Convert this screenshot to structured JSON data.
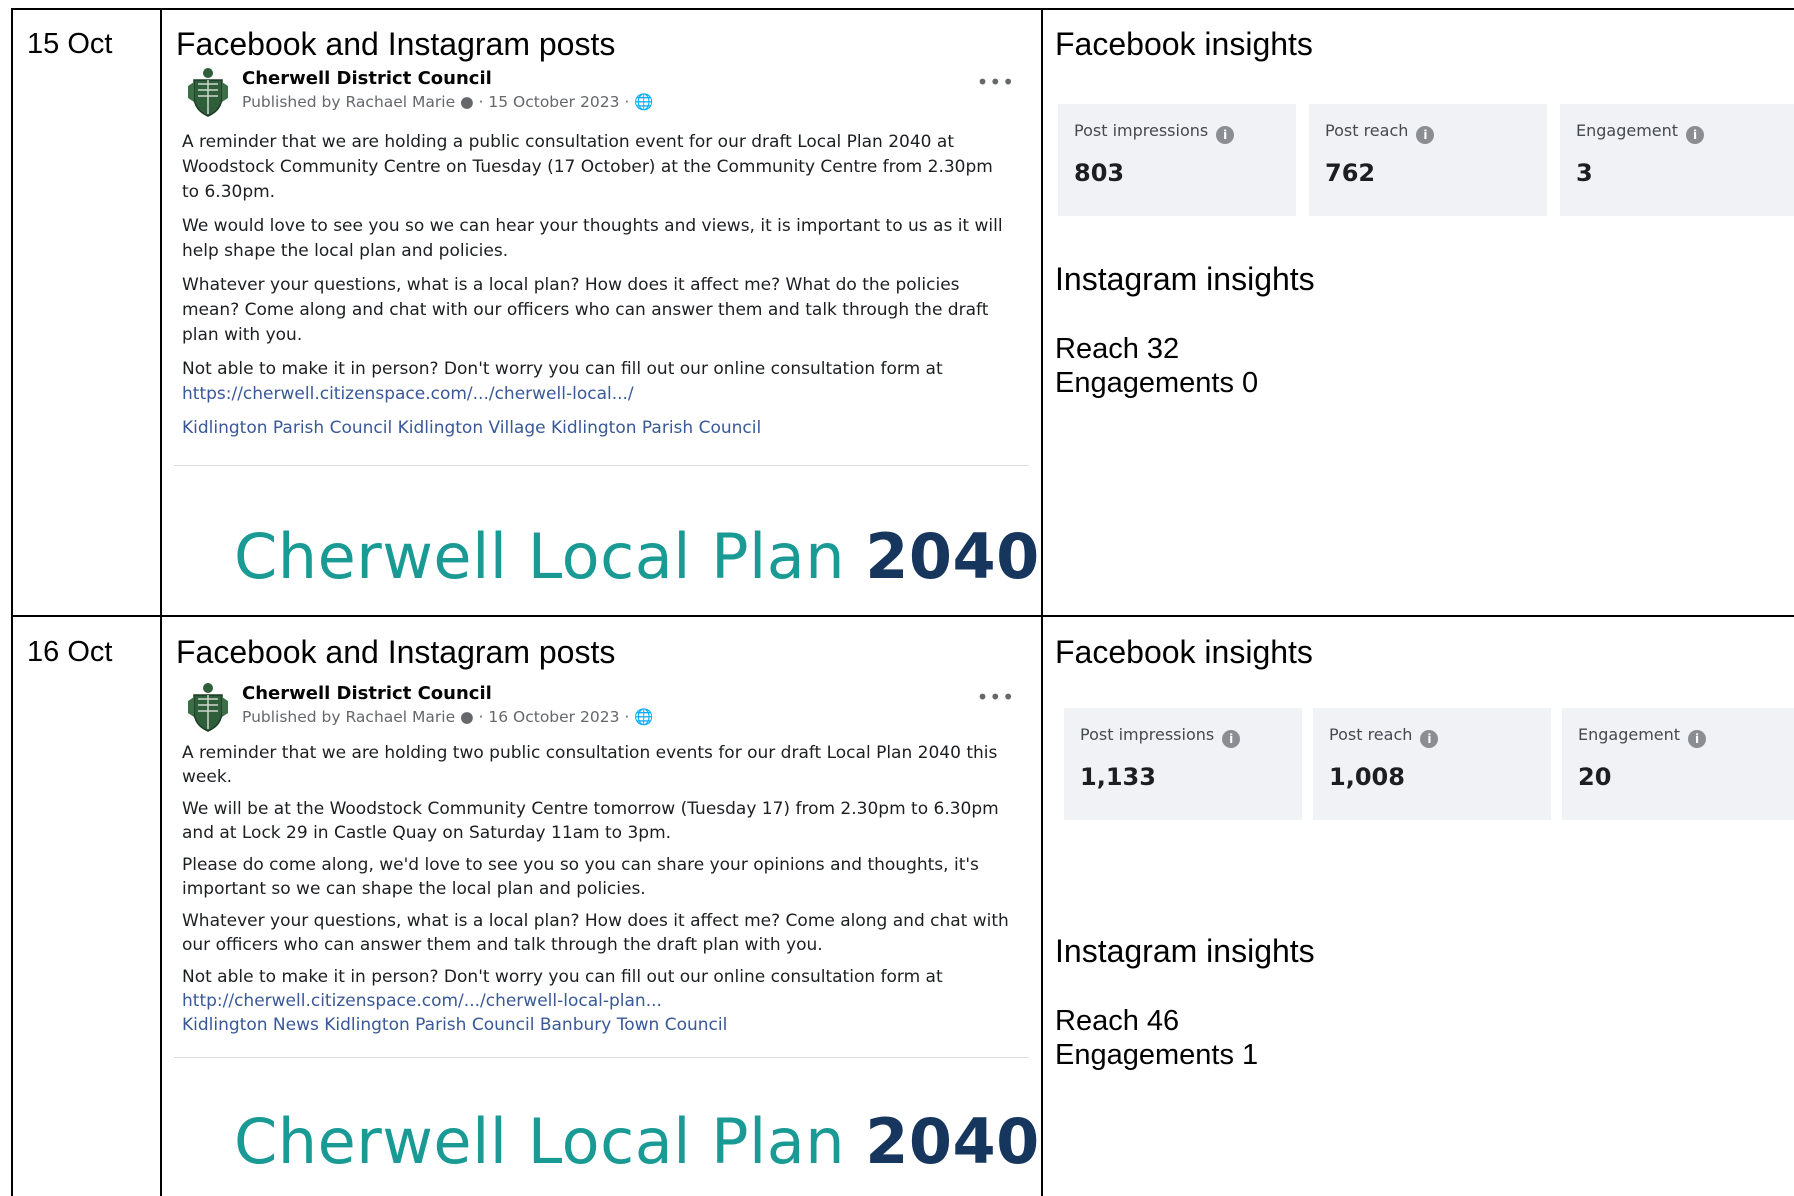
{
  "rows": [
    {
      "date": "15 Oct",
      "posts_heading": "Facebook and Instagram posts",
      "post": {
        "page_name": "Cherwell District Council",
        "published_by": "Published by Rachael Marie",
        "date": "15 October 2023",
        "paragraphs": [
          "A reminder that we are holding a public consultation event for our draft Local Plan 2040 at Woodstock Community Centre on Tuesday (17 October) at the Community Centre from 2.30pm to 6.30pm.",
          "We would love to see you so we can hear your thoughts and views, it is important to us as it will help shape the local plan and policies.",
          "Whatever your questions, what is a local plan? How does it affect me? What do the policies mean? Come along and chat with our officers who can answer them and talk through the draft plan with you.",
          "Not able to make it in person? Don't worry you can fill out our online consultation form at"
        ],
        "link": "https://cherwell.citizenspace.com/.../cherwell-local.../",
        "tags": "Kidlington Parish Council Kidlington Village Kidlington Parish Council",
        "banner_text": "Cherwell Local Plan",
        "banner_year": "2040"
      },
      "facebook_heading": "Facebook insights",
      "tiles": [
        {
          "label": "Post impressions",
          "value": "803"
        },
        {
          "label": "Post reach",
          "value": "762"
        },
        {
          "label": "Engagement",
          "value": "3"
        }
      ],
      "instagram_heading": "Instagram insights",
      "instagram": {
        "reach": "Reach 32",
        "engagements": "Engagements 0"
      }
    },
    {
      "date": "16 Oct",
      "posts_heading": "Facebook and Instagram posts",
      "post": {
        "page_name": "Cherwell District Council",
        "published_by": "Published by Rachael Marie",
        "date": "16 October 2023",
        "paragraphs": [
          "A reminder that we are holding two public consultation events for our draft Local Plan 2040 this week.",
          "We will be at the Woodstock Community Centre tomorrow (Tuesday 17) from 2.30pm to 6.30pm and at Lock 29 in Castle Quay on Saturday 11am to 3pm.",
          "Please do come along, we'd love to see you so you can share your opinions and thoughts, it's important so we can shape the local plan and policies.",
          "Whatever your questions, what is a local plan? How does it affect me? Come along and chat with our officers who can answer them and talk through the draft plan with you.",
          "Not able to make it in person? Don't worry you can fill out our online consultation form at"
        ],
        "link": "http://cherwell.citizenspace.com/.../cherwell-local-plan...",
        "tags": "Kidlington News Kidlington Parish Council Banbury Town Council",
        "banner_text": "Cherwell Local Plan",
        "banner_year": "2040"
      },
      "facebook_heading": "Facebook insights",
      "tiles": [
        {
          "label": "Post impressions",
          "value": "1,133"
        },
        {
          "label": "Post reach",
          "value": "1,008"
        },
        {
          "label": "Engagement",
          "value": "20"
        }
      ],
      "instagram_heading": "Instagram insights",
      "instagram": {
        "reach": "Reach 46",
        "engagements": "Engagements 1"
      }
    }
  ],
  "icons": {
    "info": "info-icon",
    "globe": "globe-icon",
    "more": "more-options-icon",
    "crest": "council-crest-icon"
  }
}
